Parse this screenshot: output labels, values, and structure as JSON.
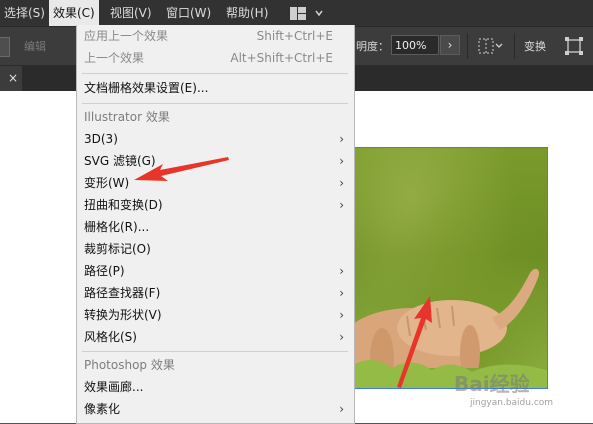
{
  "menubar": {
    "items": [
      {
        "label": "选择(S)"
      },
      {
        "label": "效果(C)"
      },
      {
        "label": "视图(V)"
      },
      {
        "label": "窗口(W)"
      },
      {
        "label": "帮助(H)"
      }
    ]
  },
  "control_bar": {
    "edit_label": "编辑",
    "opacity_label": "明度：",
    "opacity_value": "100%",
    "opacity_arrow": "›",
    "transform_label": "变换"
  },
  "tab": {
    "close": "×"
  },
  "effect_menu": {
    "items": [
      {
        "label": "应用上一个效果",
        "shortcut": "Shift+Ctrl+E",
        "disabled": true
      },
      {
        "label": "上一个效果",
        "shortcut": "Alt+Shift+Ctrl+E",
        "disabled": true
      },
      {
        "label": "文档栅格效果设置(E)..."
      },
      {
        "label": "Illustrator 效果",
        "header": true
      },
      {
        "label": "3D(3)",
        "submenu": true
      },
      {
        "label": "SVG 滤镜(G)",
        "submenu": true
      },
      {
        "label": "变形(W)",
        "submenu": true
      },
      {
        "label": "扭曲和变换(D)",
        "submenu": true
      },
      {
        "label": "栅格化(R)..."
      },
      {
        "label": "裁剪标记(O)"
      },
      {
        "label": "路径(P)",
        "submenu": true
      },
      {
        "label": "路径查找器(F)",
        "submenu": true
      },
      {
        "label": "转换为形状(V)",
        "submenu": true
      },
      {
        "label": "风格化(S)",
        "submenu": true
      },
      {
        "label": "Photoshop 效果",
        "header": true
      },
      {
        "label": "效果画廊..."
      },
      {
        "label": "像素化",
        "submenu": true
      }
    ],
    "submenu_glyph": "›"
  },
  "watermark": {
    "brand": "Bai经验",
    "url": "jingyan.baidu.com"
  },
  "colors": {
    "menubar_bg": "#323232",
    "menu_bg": "#f0f0f0",
    "annotation_red": "#e8352b",
    "selection_blue": "#3f7be0"
  }
}
